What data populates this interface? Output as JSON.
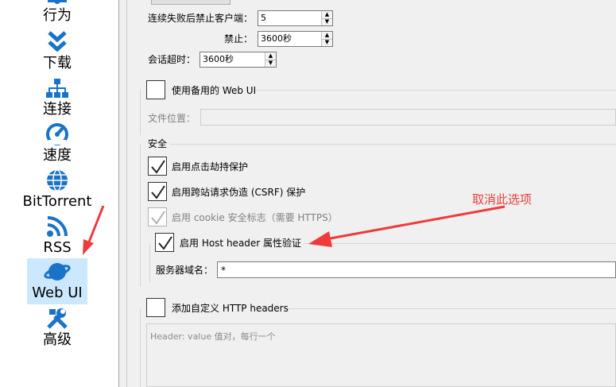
{
  "sidebar": {
    "items": [
      {
        "label": "行为",
        "icon": "behavior-icon"
      },
      {
        "label": "下载",
        "icon": "download-chevrons-icon"
      },
      {
        "label": "连接",
        "icon": "network-icon"
      },
      {
        "label": "速度",
        "icon": "speedometer-icon"
      },
      {
        "label": "BitTorrent",
        "icon": "globe-icon"
      },
      {
        "label": "RSS",
        "icon": "rss-icon"
      },
      {
        "label": "Web UI",
        "icon": "planet-icon",
        "selected": true
      },
      {
        "label": "高级",
        "icon": "tools-icon"
      }
    ]
  },
  "auth": {
    "ban_label": "连续失败后禁止客户端：",
    "ban_value": "5",
    "ban_duration_label": "禁止：",
    "ban_duration_value": "3600秒",
    "session_timeout_label": "会话超时：",
    "session_timeout_value": "3600秒"
  },
  "alt_webui": {
    "label": "使用备用的 Web UI",
    "checked": false,
    "file_location_label": "文件位置："
  },
  "security": {
    "title": "安全",
    "clickjacking_label": "启用点击劫持保护",
    "csrf_label": "启用跨站请求伪造 (CSRF) 保护",
    "cookie_label": "启用 cookie 安全标志（需要 HTTPS）",
    "host_header_label": "启用 Host header 属性验证",
    "server_domains_label": "服务器域名：",
    "server_domains_value": "*"
  },
  "custom_headers": {
    "label": "添加自定义 HTTP headers",
    "placeholder": "Header: value 值对，每行一个"
  },
  "annotation": {
    "text": "取消此选项",
    "color": "#ee3b3b"
  }
}
